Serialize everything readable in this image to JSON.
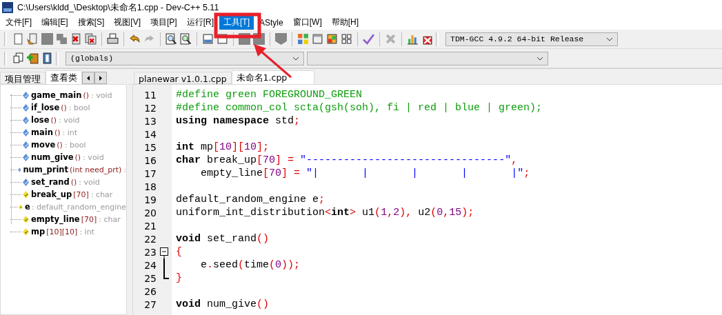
{
  "window": {
    "title": "C:\\Users\\kldd_\\Desktop\\未命名1.cpp - Dev-C++ 5.11"
  },
  "menu": [
    {
      "label": "文件[F]",
      "selected": false
    },
    {
      "label": "编辑[E]",
      "selected": false
    },
    {
      "label": "搜索[S]",
      "selected": false
    },
    {
      "label": "视图[V]",
      "selected": false
    },
    {
      "label": "项目[P]",
      "selected": false
    },
    {
      "label": "运行[R]",
      "selected": false
    },
    {
      "label": "工具[T]",
      "selected": true
    },
    {
      "label": "AStyle",
      "selected": false
    },
    {
      "label": "窗口[W]",
      "selected": false
    },
    {
      "label": "帮助[H]",
      "selected": false
    }
  ],
  "toolbar": [
    {
      "kind": "new",
      "disabled": false
    },
    {
      "kind": "open",
      "disabled": false
    },
    {
      "kind": "save",
      "disabled": true
    },
    {
      "kind": "saveall",
      "disabled": true
    },
    {
      "kind": "close",
      "disabled": false
    },
    {
      "kind": "closeall",
      "disabled": false
    },
    {
      "kind": "sep"
    },
    {
      "kind": "print",
      "disabled": false
    },
    {
      "kind": "sep"
    },
    {
      "kind": "undo",
      "disabled": false
    },
    {
      "kind": "redo",
      "disabled": true
    },
    {
      "kind": "sep"
    },
    {
      "kind": "find",
      "disabled": false
    },
    {
      "kind": "replace",
      "disabled": false
    },
    {
      "kind": "sep"
    },
    {
      "kind": "indent",
      "disabled": false
    },
    {
      "kind": "unindent",
      "disabled": false
    },
    {
      "kind": "sep"
    },
    {
      "kind": "compile",
      "disabled": true
    },
    {
      "kind": "run",
      "disabled": true
    },
    {
      "kind": "sep"
    },
    {
      "kind": "debug",
      "disabled": true
    },
    {
      "kind": "sep"
    },
    {
      "kind": "grid",
      "disabled": false
    },
    {
      "kind": "window",
      "disabled": false
    },
    {
      "kind": "colors",
      "disabled": false
    },
    {
      "kind": "tiles",
      "disabled": false
    },
    {
      "kind": "sep"
    },
    {
      "kind": "check",
      "disabled": false
    },
    {
      "kind": "sep"
    },
    {
      "kind": "stop",
      "disabled": true
    },
    {
      "kind": "sep"
    },
    {
      "kind": "chart",
      "disabled": false
    },
    {
      "kind": "profile",
      "disabled": false
    }
  ],
  "compiler_select": {
    "value": "TDM-GCC 4.9.2 64-bit Release"
  },
  "toolbar2": [
    {
      "kind": "goto",
      "disabled": false
    },
    {
      "kind": "add",
      "disabled": false
    },
    {
      "kind": "bookmark",
      "disabled": false
    }
  ],
  "scope_select": {
    "value": "(globals)"
  },
  "left_tabs": [
    {
      "label": "项目管理",
      "selected": false
    },
    {
      "label": "查看类",
      "selected": true
    }
  ],
  "class_tree": [
    {
      "kind": "function",
      "name": "game_main",
      "args": "()",
      "type": ": void"
    },
    {
      "kind": "function",
      "name": "if_lose",
      "args": "()",
      "type": ": bool"
    },
    {
      "kind": "function",
      "name": "lose",
      "args": "()",
      "type": ": void"
    },
    {
      "kind": "function",
      "name": "main",
      "args": "()",
      "type": ": int"
    },
    {
      "kind": "function",
      "name": "move",
      "args": "()",
      "type": ": bool"
    },
    {
      "kind": "function",
      "name": "num_give",
      "args": "()",
      "type": ": void"
    },
    {
      "kind": "function",
      "name": "num_print",
      "args": "(int need_prt)",
      "type": ":"
    },
    {
      "kind": "function",
      "name": "set_rand",
      "args": "()",
      "type": ": void"
    },
    {
      "kind": "variable",
      "name": "break_up",
      "args": "[70]",
      "type": ": char"
    },
    {
      "kind": "variable",
      "name": "e",
      "type": ": default_random_engine"
    },
    {
      "kind": "variable",
      "name": "empty_line",
      "args": "[70]",
      "type": ": char"
    },
    {
      "kind": "variable",
      "name": "mp",
      "args": "[10][10]",
      "type": ": int"
    }
  ],
  "editor_tabs": [
    {
      "label": "planewar v1.0.1.cpp",
      "selected": false
    },
    {
      "label": "未命名1.cpp",
      "selected": true
    }
  ],
  "code": [
    {
      "number": "11",
      "tokens": [
        {
          "kind": "pre",
          "text": "#define green FOREGROUND_GREEN"
        }
      ]
    },
    {
      "number": "12",
      "tokens": [
        {
          "kind": "pre",
          "text": "#define common_col scta(gsh(soh), fi | red | blue | green);"
        }
      ]
    },
    {
      "number": "13",
      "tokens": [
        {
          "kind": "kw",
          "text": "using namespace"
        },
        {
          "kind": "plain",
          "text": " std"
        },
        {
          "kind": "sym",
          "text": ";"
        }
      ]
    },
    {
      "number": "14"
    },
    {
      "number": "15",
      "tokens": [
        {
          "kind": "kw",
          "text": "int"
        },
        {
          "kind": "plain",
          "text": " mp"
        },
        {
          "kind": "sym",
          "text": "["
        },
        {
          "kind": "num",
          "text": "10"
        },
        {
          "kind": "sym",
          "text": "]["
        },
        {
          "kind": "num",
          "text": "10"
        },
        {
          "kind": "sym",
          "text": "];"
        }
      ]
    },
    {
      "number": "16",
      "tokens": [
        {
          "kind": "kw",
          "text": "char"
        },
        {
          "kind": "plain",
          "text": " break_up"
        },
        {
          "kind": "sym",
          "text": "["
        },
        {
          "kind": "num",
          "text": "70"
        },
        {
          "kind": "sym",
          "text": "] = "
        },
        {
          "kind": "str",
          "text": "\"--------------------------------\""
        },
        {
          "kind": "sym",
          "text": ","
        }
      ]
    },
    {
      "number": "17",
      "tokens": [
        {
          "kind": "plain",
          "text": "    empty_line"
        },
        {
          "kind": "sym",
          "text": "["
        },
        {
          "kind": "num",
          "text": "70"
        },
        {
          "kind": "sym",
          "text": "] = "
        },
        {
          "kind": "str",
          "text": "\"|       |       |       |       |\""
        },
        {
          "kind": "sym",
          "text": ";"
        }
      ]
    },
    {
      "number": "18"
    },
    {
      "number": "19",
      "tokens": [
        {
          "kind": "plain",
          "text": "default_random_engine e"
        },
        {
          "kind": "sym",
          "text": ";"
        }
      ]
    },
    {
      "number": "20",
      "tokens": [
        {
          "kind": "plain",
          "text": "uniform_int_distribution"
        },
        {
          "kind": "sym",
          "text": "<"
        },
        {
          "kind": "kw",
          "text": "int"
        },
        {
          "kind": "sym",
          "text": ">"
        },
        {
          "kind": "plain",
          "text": " u1"
        },
        {
          "kind": "sym",
          "text": "("
        },
        {
          "kind": "num",
          "text": "1"
        },
        {
          "kind": "sym",
          "text": ","
        },
        {
          "kind": "num",
          "text": "2"
        },
        {
          "kind": "sym",
          "text": "),"
        },
        {
          "kind": "plain",
          "text": " u2"
        },
        {
          "kind": "sym",
          "text": "("
        },
        {
          "kind": "num",
          "text": "0"
        },
        {
          "kind": "sym",
          "text": ","
        },
        {
          "kind": "num",
          "text": "15"
        },
        {
          "kind": "sym",
          "text": ");"
        }
      ]
    },
    {
      "number": "21"
    },
    {
      "number": "22",
      "tokens": [
        {
          "kind": "kw",
          "text": "void"
        },
        {
          "kind": "plain",
          "text": " set_rand"
        },
        {
          "kind": "sym",
          "text": "()"
        }
      ]
    },
    {
      "number": "23",
      "fold_start": true,
      "tokens": [
        {
          "kind": "sym",
          "text": "{"
        }
      ]
    },
    {
      "number": "24",
      "in_fold": true,
      "tokens": [
        {
          "kind": "plain",
          "text": "    e"
        },
        {
          "kind": "sym",
          "text": "."
        },
        {
          "kind": "plain",
          "text": "seed"
        },
        {
          "kind": "sym",
          "text": "("
        },
        {
          "kind": "plain",
          "text": "time"
        },
        {
          "kind": "sym",
          "text": "("
        },
        {
          "kind": "num",
          "text": "0"
        },
        {
          "kind": "sym",
          "text": "));"
        }
      ]
    },
    {
      "number": "25",
      "fold_end": true,
      "tokens": [
        {
          "kind": "sym",
          "text": "}"
        }
      ]
    },
    {
      "number": "26"
    },
    {
      "number": "27",
      "tokens": [
        {
          "kind": "kw",
          "text": "void"
        },
        {
          "kind": "plain",
          "text": " num_give"
        },
        {
          "kind": "sym",
          "text": "()"
        }
      ]
    }
  ]
}
